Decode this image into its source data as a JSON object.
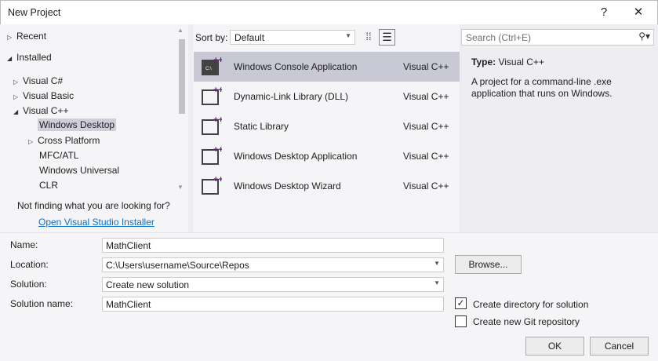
{
  "window": {
    "title": "New Project",
    "help": "?",
    "close": "✕"
  },
  "tree": {
    "recent": "Recent",
    "installed": "Installed",
    "items": [
      {
        "label": "Visual C#"
      },
      {
        "label": "Visual Basic"
      },
      {
        "label": "Visual C++"
      },
      {
        "label": "Windows Desktop"
      },
      {
        "label": "Cross Platform"
      },
      {
        "label": "MFC/ATL"
      },
      {
        "label": "Windows Universal"
      },
      {
        "label": "CLR"
      }
    ],
    "not_finding": "Not finding what you are looking for?",
    "installer_link": "Open Visual Studio Installer"
  },
  "sort": {
    "label": "Sort by:",
    "value": "Default"
  },
  "search": {
    "placeholder": "Search (Ctrl+E)"
  },
  "templates": [
    {
      "name": "Windows Console Application",
      "lang": "Visual C++",
      "icon": "console-app-icon"
    },
    {
      "name": "Dynamic-Link Library (DLL)",
      "lang": "Visual C++",
      "icon": "dll-icon"
    },
    {
      "name": "Static Library",
      "lang": "Visual C++",
      "icon": "static-library-icon"
    },
    {
      "name": "Windows Desktop Application",
      "lang": "Visual C++",
      "icon": "desktop-app-icon"
    },
    {
      "name": "Windows Desktop Wizard",
      "lang": "Visual C++",
      "icon": "desktop-wizard-icon"
    }
  ],
  "details": {
    "type_label": "Type:",
    "type_value": "Visual C++",
    "description": "A project for a command-line .exe application that runs on Windows."
  },
  "form": {
    "name_label": "Name:",
    "name_value": "MathClient",
    "location_label": "Location:",
    "location_value": "C:\\Users\\username\\Source\\Repos",
    "browse": "Browse...",
    "solution_label": "Solution:",
    "solution_value": "Create new solution",
    "solution_name_label": "Solution name:",
    "solution_name_value": "MathClient",
    "create_dir": "Create directory for solution",
    "create_dir_checked": true,
    "create_git": "Create new Git repository",
    "create_git_checked": false,
    "ok": "OK",
    "cancel": "Cancel"
  },
  "colors": {
    "accent": "#68217a",
    "selection": "#c9c9d6",
    "link": "#0e70c0"
  }
}
